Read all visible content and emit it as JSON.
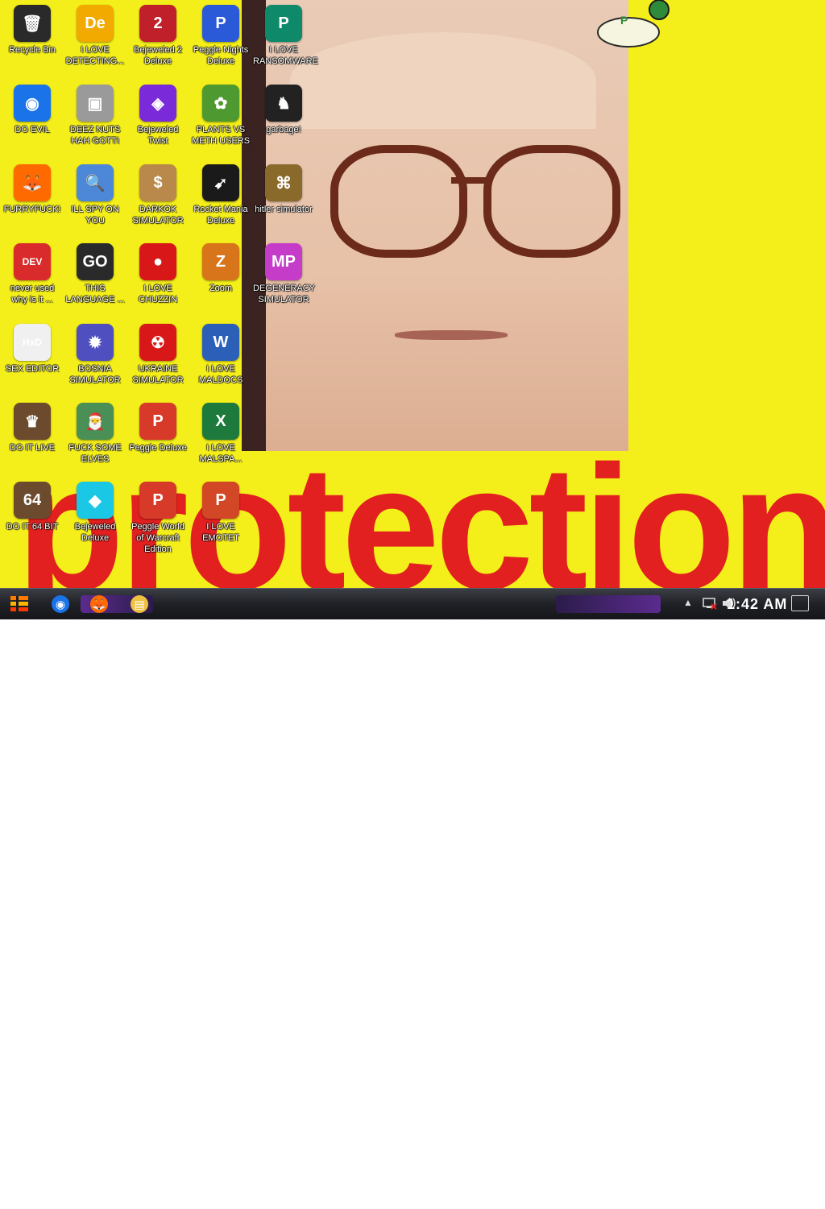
{
  "desktop": {
    "icons": [
      {
        "label": "Recycle Bin",
        "icon": "recycle-bin-icon",
        "color": "#2a2a2a",
        "glyph": "🗑"
      },
      {
        "label": "DO EVIL",
        "icon": "chrome-icon",
        "color": "#1a73e8",
        "glyph": "◉"
      },
      {
        "label": "FURRYFUCK!",
        "icon": "firefox-icon",
        "color": "#ff6a00",
        "glyph": "🦊"
      },
      {
        "label": "never used why is it ...",
        "icon": "devcpp-icon",
        "color": "#d92b2b",
        "glyph": "DEV"
      },
      {
        "label": "SEX EDITOR",
        "icon": "hxd-icon",
        "color": "#f0f0f0",
        "glyph": "HxD"
      },
      {
        "label": "DO IT LIVE",
        "icon": "portrait-icon",
        "color": "#6b4a2e",
        "glyph": "♛"
      },
      {
        "label": "DO IT 64 BIT",
        "icon": "portrait-64-icon",
        "color": "#6b4a2e",
        "glyph": "64"
      },
      {
        "label": "I LOVE DETECTING...",
        "icon": "de-icon",
        "color": "#f2a900",
        "glyph": "De"
      },
      {
        "label": "DEEZ NUTS HAH GOTTI",
        "icon": "stacked-windows-icon",
        "color": "#9a9a9a",
        "glyph": "▣"
      },
      {
        "label": "ILL SPY ON YOU",
        "icon": "spy-icon",
        "color": "#4d88d8",
        "glyph": "🔍"
      },
      {
        "label": "THIS LANGUAGE ...",
        "icon": "goland-icon",
        "color": "#2a2a2a",
        "glyph": "GO"
      },
      {
        "label": "BOSNIA SIMULATOR",
        "icon": "spiky-ball-icon",
        "color": "#4f4fc0",
        "glyph": "✹"
      },
      {
        "label": "FUCK SOME ELVES",
        "icon": "santa-icon",
        "color": "#4a8f55",
        "glyph": "🎅"
      },
      {
        "label": "Bejeweled Deluxe",
        "icon": "diamond-icon",
        "color": "#1ac8e6",
        "glyph": "◆"
      },
      {
        "label": "Bejeweled 2 Deluxe",
        "icon": "bejeweled2-icon",
        "color": "#c0202a",
        "glyph": "2"
      },
      {
        "label": "Bejeweled Twist",
        "icon": "bejeweled-twist-icon",
        "color": "#7a2ad8",
        "glyph": "◈"
      },
      {
        "label": "DARKOK SIMULATOR",
        "icon": "money-bag-icon",
        "color": "#b8894a",
        "glyph": "$"
      },
      {
        "label": "I LOVE CHUZZIN",
        "icon": "chuzzle-icon",
        "color": "#d81818",
        "glyph": "●"
      },
      {
        "label": "UKRAINE SIMULATOR",
        "icon": "radiation-icon",
        "color": "#d81818",
        "glyph": "☢"
      },
      {
        "label": "Peggle Deluxe",
        "icon": "peggle-icon",
        "color": "#d83a2a",
        "glyph": "P"
      },
      {
        "label": "Peggle World of Warcraft Edition",
        "icon": "peggle-wow-icon",
        "color": "#d83a2a",
        "glyph": "P"
      },
      {
        "label": "Peggle Nights Deluxe",
        "icon": "peggle-nights-icon",
        "color": "#2a5ad8",
        "glyph": "P"
      },
      {
        "label": "PLANTS VS METH USERS",
        "icon": "pvz-icon",
        "color": "#4f9a30",
        "glyph": "✿"
      },
      {
        "label": "Rocket Mania Deluxe",
        "icon": "rocket-icon",
        "color": "#1a1a1a",
        "glyph": "➹"
      },
      {
        "label": "Zoom",
        "icon": "zuma-icon",
        "color": "#d8741a",
        "glyph": "Z"
      },
      {
        "label": "I LOVE MALDOCS",
        "icon": "word-icon",
        "color": "#2b5fb8",
        "glyph": "W"
      },
      {
        "label": "I LOVE MALSPA...",
        "icon": "excel-icon",
        "color": "#1d7a3c",
        "glyph": "X"
      },
      {
        "label": "I LOVE EMOTET",
        "icon": "powerpoint-icon",
        "color": "#d24726",
        "glyph": "P"
      },
      {
        "label": "I LOVE RANSOMWARE",
        "icon": "publisher-icon",
        "color": "#0e8a6a",
        "glyph": "P"
      },
      {
        "label": "garbage!",
        "icon": "horse-icon",
        "color": "#222222",
        "glyph": "♞"
      },
      {
        "label": "hitler simulator",
        "icon": "coin-icon",
        "color": "#8a6a2a",
        "glyph": "⌘"
      },
      {
        "label": "DEGENERACY SIMULATOR",
        "icon": "logo-mp-icon",
        "color": "#c43cc8",
        "glyph": "MP"
      }
    ],
    "wallpaper_word": "protection"
  },
  "taskbar": {
    "start_icon": "start-icon",
    "apps": [
      {
        "icon": "chrome-icon",
        "glyph": "◉",
        "color": "#1a73e8"
      },
      {
        "icon": "firefox-icon",
        "glyph": "🦊",
        "color": "#ff6a00"
      },
      {
        "icon": "file-explorer-icon",
        "glyph": "▤",
        "color": "#f0c040"
      }
    ],
    "clock": "1:42 AM"
  }
}
